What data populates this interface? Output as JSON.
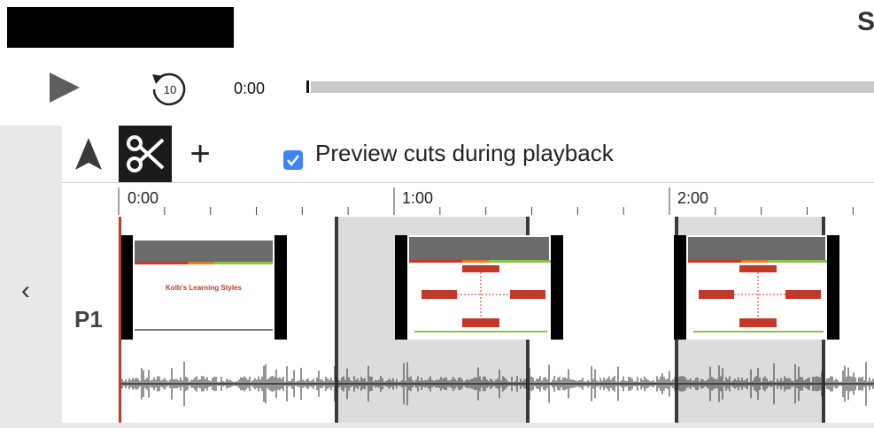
{
  "header": {
    "title_partial": "S"
  },
  "player": {
    "time": "0:00",
    "progress": 0.0
  },
  "toolbar": {
    "preview_label": "Preview cuts during playback",
    "preview_checked": true
  },
  "ruler": {
    "labels": [
      "0:00",
      "1:00",
      "2:00"
    ]
  },
  "track": {
    "label": "P1"
  },
  "slides": {
    "title": "Kolb's Learning Styles"
  },
  "colors": {
    "accent": "#3b86f3",
    "playhead": "#c0392b",
    "cut_region": "#dcdcdc",
    "active_tool": "#1b1b1b"
  },
  "icons": {
    "play": "play-icon",
    "replay": "replay-10-icon",
    "select": "arrow-icon",
    "cut": "scissors-icon",
    "add": "plus-icon",
    "collapse": "chevron-left-icon"
  }
}
